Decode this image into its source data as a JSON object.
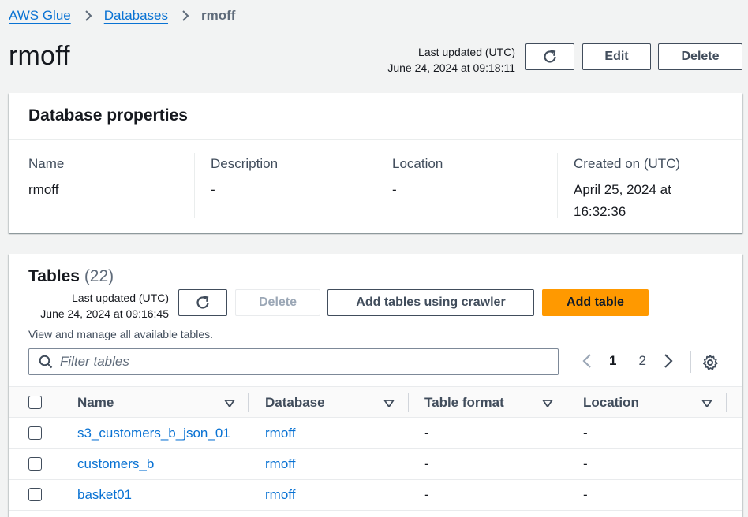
{
  "breadcrumb": {
    "items": [
      {
        "label": "AWS Glue"
      },
      {
        "label": "Databases"
      }
    ],
    "current": "rmoff"
  },
  "header": {
    "title": "rmoff",
    "last_updated_label": "Last updated (UTC)",
    "last_updated_value": "June 24, 2024 at 09:18:11",
    "refresh_icon": "refresh-icon",
    "edit_label": "Edit",
    "delete_label": "Delete"
  },
  "database_properties": {
    "title": "Database properties",
    "fields": [
      {
        "label": "Name",
        "value": "rmoff"
      },
      {
        "label": "Description",
        "value": "-"
      },
      {
        "label": "Location",
        "value": "-"
      },
      {
        "label": "Created on (UTC)",
        "value": "April 25, 2024 at 16:32:36"
      }
    ]
  },
  "tables": {
    "title": "Tables",
    "count": "(22)",
    "last_updated_label": "Last updated (UTC)",
    "last_updated_value": "June 24, 2024 at 09:16:45",
    "description": "View and manage all available tables.",
    "delete_label": "Delete",
    "add_crawler_label": "Add tables using crawler",
    "add_table_label": "Add table",
    "filter_placeholder": "Filter tables",
    "pagination": {
      "pages": [
        "1",
        "2"
      ],
      "current": "1"
    },
    "columns": [
      "Name",
      "Database",
      "Table format",
      "Location"
    ],
    "rows": [
      {
        "name": "s3_customers_b_json_01",
        "database": "rmoff",
        "format": "-",
        "location": "-"
      },
      {
        "name": "customers_b",
        "database": "rmoff",
        "format": "-",
        "location": "-"
      },
      {
        "name": "basket01",
        "database": "rmoff",
        "format": "-",
        "location": "-"
      }
    ]
  },
  "colors": {
    "link": "#0972d3",
    "primary_button": "#ff9900",
    "background": "#f2f3f3"
  }
}
